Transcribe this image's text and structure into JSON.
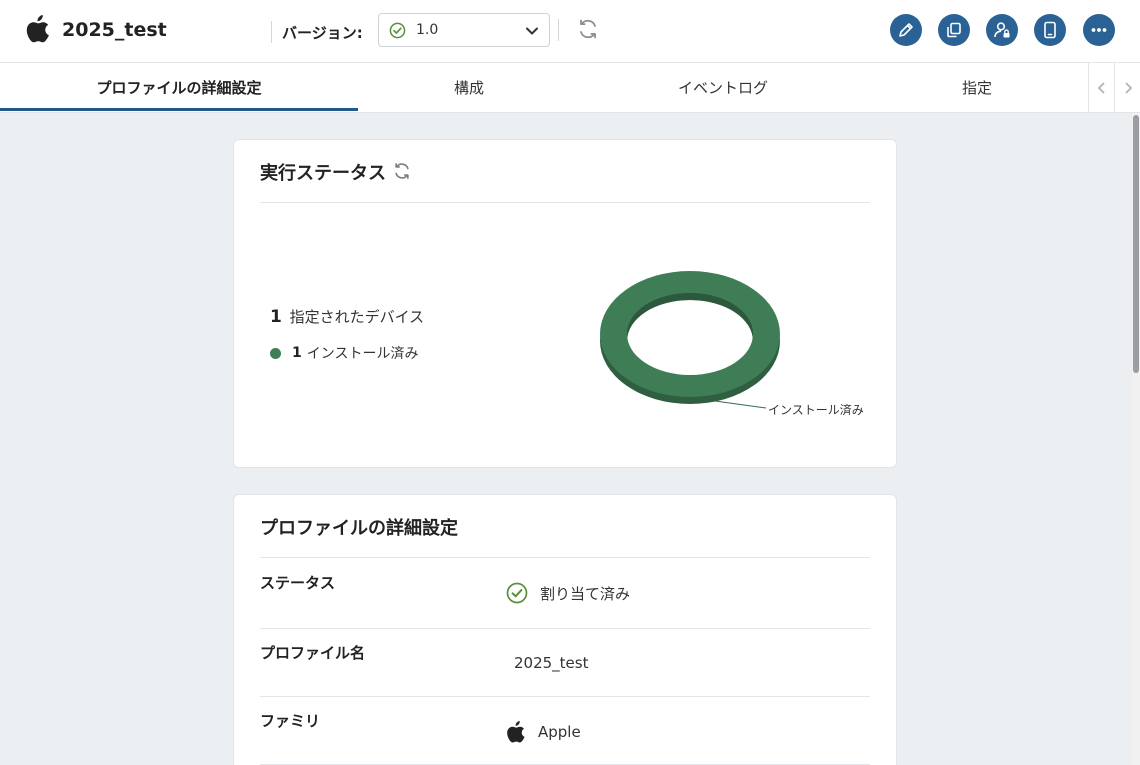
{
  "header": {
    "title": "2025_test",
    "version_label": "バージョン:",
    "version_value": "1.0",
    "actions": [
      "edit-icon",
      "copy-icon",
      "user-lock-icon",
      "device-icon",
      "more-icon"
    ]
  },
  "tabs": [
    {
      "label": "プロファイルの詳細設定",
      "active": true
    },
    {
      "label": "構成",
      "active": false
    },
    {
      "label": "イベントログ",
      "active": false
    },
    {
      "label": "指定",
      "active": false
    }
  ],
  "exec_status": {
    "title": "実行ステータス",
    "assigned_count": "1",
    "assigned_label": "指定されたデバイス",
    "installed_count": "1",
    "installed_label": "インストール済み",
    "chart_label": "インストール済み"
  },
  "chart_data": {
    "type": "pie",
    "categories": [
      "インストール済み"
    ],
    "values": [
      1
    ],
    "colors": [
      "#3f7d57"
    ]
  },
  "details": {
    "title": "プロファイルの詳細設定",
    "rows": [
      {
        "label": "ステータス",
        "value": "割り当て済み",
        "icon": "check-circle-icon"
      },
      {
        "label": "プロファイル名",
        "value": "2025_test"
      },
      {
        "label": "ファミリ",
        "value": "Apple",
        "icon": "apple-icon"
      }
    ]
  },
  "colors": {
    "accent": "#2a6295",
    "tab_underline": "#1f5a8a",
    "success": "#5a8f3a",
    "donut": "#3f7d57",
    "background": "#eceff1"
  }
}
